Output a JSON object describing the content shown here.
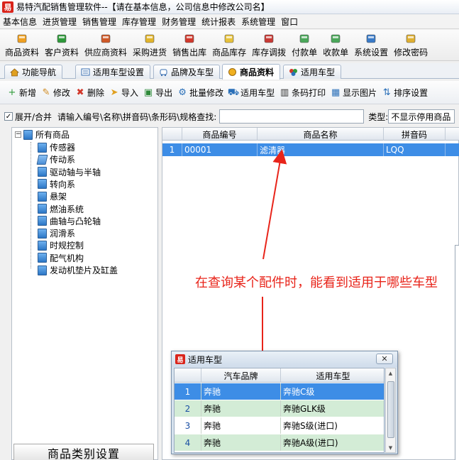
{
  "window": {
    "title": "易特汽配销售管理软件--【请在基本信息，公司信息中修改公司名】",
    "logo_char": "易"
  },
  "menubar": [
    "基本信息",
    "进货管理",
    "销售管理",
    "库存管理",
    "财务管理",
    "统计报表",
    "系统管理",
    "窗口"
  ],
  "toolbar": [
    {
      "label": "商品资料",
      "icon": "goods-icon",
      "color": "#f0a020"
    },
    {
      "label": "客户资料",
      "icon": "customer-icon",
      "color": "#2e9a3a"
    },
    {
      "label": "供应商资料",
      "icon": "supplier-icon",
      "color": "#d05a28"
    },
    {
      "label": "采购进货",
      "icon": "purchase-icon",
      "color": "#e3b52a"
    },
    {
      "label": "销售出库",
      "icon": "sales-icon",
      "color": "#d2382b"
    },
    {
      "label": "商品库存",
      "icon": "inventory-icon",
      "color": "#e8c23a"
    },
    {
      "label": "库存调拨",
      "icon": "transfer-icon",
      "color": "#c93a35"
    },
    {
      "label": "付款单",
      "icon": "payment-icon",
      "color": "#4aa85a"
    },
    {
      "label": "收款单",
      "icon": "receipt-icon",
      "color": "#4aa85a"
    },
    {
      "label": "系统设置",
      "icon": "settings-icon",
      "color": "#3a7bc8"
    },
    {
      "label": "修改密码",
      "icon": "password-icon",
      "color": "#e0b030"
    }
  ],
  "tabs": [
    {
      "label": "功能导航",
      "active": false
    },
    {
      "label": "适用车型设置",
      "active": false
    },
    {
      "label": "品牌及车型",
      "active": false
    },
    {
      "label": "商品资料",
      "active": true
    },
    {
      "label": "适用车型",
      "active": false
    }
  ],
  "subtoolbar": [
    {
      "label": "新增",
      "icon": "plus-icon",
      "glyph": "+",
      "color": "#2e9a3a"
    },
    {
      "label": "修改",
      "icon": "edit-icon",
      "glyph": "✎",
      "color": "#d08a20"
    },
    {
      "label": "删除",
      "icon": "delete-icon",
      "glyph": "✖",
      "color": "#d2382b"
    },
    {
      "label": "导入",
      "icon": "import-icon",
      "glyph": "➤",
      "color": "#e0a020"
    },
    {
      "label": "导出",
      "icon": "export-icon",
      "glyph": "▣",
      "color": "#2e8a3a"
    },
    {
      "label": "批量修改",
      "icon": "batch-edit-icon",
      "glyph": "⚙",
      "color": "#2a6fb8"
    },
    {
      "label": "适用车型",
      "icon": "car-icon",
      "glyph": "⛟",
      "color": "#2a6fb8"
    },
    {
      "label": "条码打印",
      "icon": "barcode-icon",
      "glyph": "▥",
      "color": "#333333"
    },
    {
      "label": "显示图片",
      "icon": "image-icon",
      "glyph": "▦",
      "color": "#2a6fb8"
    },
    {
      "label": "排序设置",
      "icon": "sort-icon",
      "glyph": "⇅",
      "color": "#2a6fb8"
    }
  ],
  "filterbar": {
    "expand_label": "展开/合并",
    "expand_checked": "✓",
    "search_label": "请输入编号\\名称\\拼音码\\条形码\\规格查找:",
    "search_value": "",
    "type_label": "类型:",
    "type_value": "不显示停用商品"
  },
  "tree": {
    "root": "所有商品",
    "root_toggle": "−",
    "children": [
      "传感器",
      "传动系",
      "驱动轴与半轴",
      "转向系",
      "悬架",
      "燃油系统",
      "曲轴与凸轮轴",
      "润滑系",
      "时规控制",
      "配气机构",
      "发动机垫片及缸盖"
    ],
    "bottom_button": "商品类别设置"
  },
  "grid": {
    "columns": [
      "商品编号",
      "商品名称",
      "拼音码"
    ],
    "rows": [
      {
        "num": "1",
        "code": "00001",
        "name": "滤清器",
        "pinyin": "LQQ"
      }
    ]
  },
  "annotation": "在查询某个配件时，能看到适用于哪些车型",
  "popup": {
    "title": "适用车型",
    "logo_char": "易",
    "close_glyph": "✕",
    "columns": [
      "汽车品牌",
      "适用车型"
    ],
    "rows": [
      {
        "num": "1",
        "brand": "奔驰",
        "model": "奔驰C级"
      },
      {
        "num": "2",
        "brand": "奔驰",
        "model": "奔驰GLK级"
      },
      {
        "num": "3",
        "brand": "奔驰",
        "model": "奔驰S级(进口)"
      },
      {
        "num": "4",
        "brand": "奔驰",
        "model": "奔驰A级(进口)"
      }
    ]
  },
  "colors": {
    "accent": "#3d8de6",
    "annotation": "#e8241a",
    "alt_row": "#d3ecd6"
  }
}
